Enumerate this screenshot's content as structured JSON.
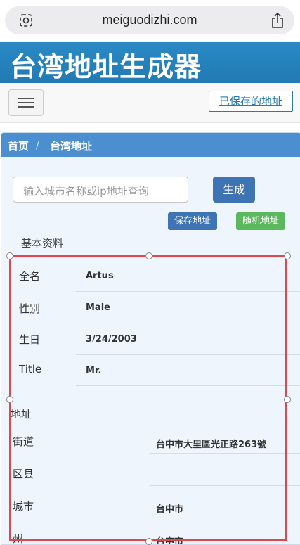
{
  "browser": {
    "url": "meiguodizhi.com"
  },
  "banner": {
    "title": "台湾地址生成器"
  },
  "nav": {
    "saved_link": "已保存的地址"
  },
  "breadcrumb": {
    "home": "首页",
    "separator": "/",
    "current": "台湾地址"
  },
  "search": {
    "placeholder": "输入城市名称或ip地址查询"
  },
  "buttons": {
    "generate": "生成",
    "save": "保存地址",
    "random": "随机地址"
  },
  "basic": {
    "heading": "基本资料",
    "rows": [
      {
        "label": "全名",
        "value": "Artus"
      },
      {
        "label": "性别",
        "value": "Male"
      },
      {
        "label": "生日",
        "value": "3/24/2003"
      },
      {
        "label": "Title",
        "value": "Mr."
      }
    ]
  },
  "address": {
    "heading": "地址",
    "rows": [
      {
        "label": "街道",
        "value": "台中市大里區光正路263號"
      },
      {
        "label": "区县",
        "value": ""
      },
      {
        "label": "城市",
        "value": "台中市"
      },
      {
        "label": "州",
        "value": "台中市"
      }
    ]
  },
  "colors": {
    "banner": "#2a8ac4",
    "panel_header": "#4b8fd0",
    "primary": "#3e74b3",
    "success": "#5cb85c",
    "selection": "#e0474c"
  }
}
